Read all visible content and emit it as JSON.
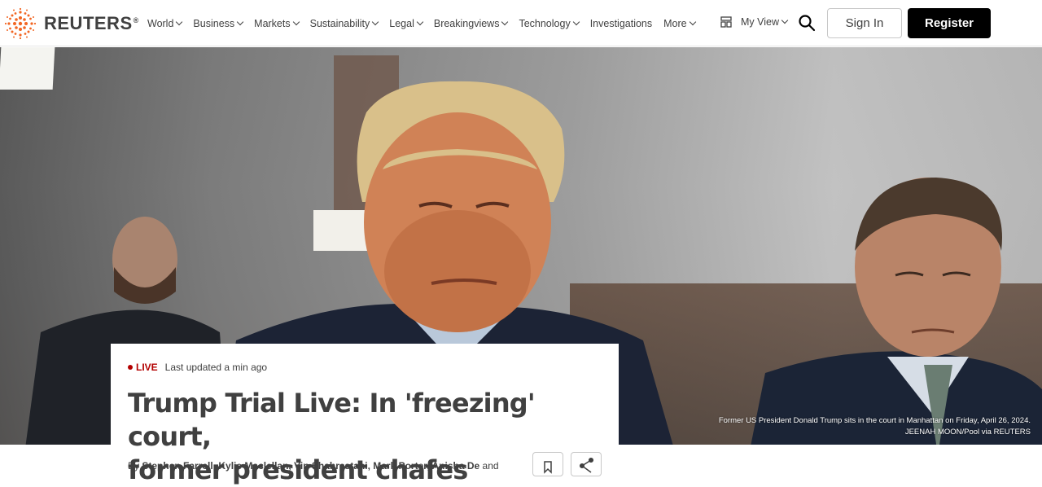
{
  "brand": {
    "name": "REUTERS",
    "registered": "®"
  },
  "nav": {
    "items": [
      {
        "label": "World",
        "dropdown": true
      },
      {
        "label": "Business",
        "dropdown": true
      },
      {
        "label": "Markets",
        "dropdown": true
      },
      {
        "label": "Sustainability",
        "dropdown": true
      },
      {
        "label": "Legal",
        "dropdown": true
      },
      {
        "label": "Breakingviews",
        "dropdown": true
      },
      {
        "label": "Technology",
        "dropdown": true
      },
      {
        "label": "Investigations",
        "dropdown": false
      },
      {
        "label": "More",
        "dropdown": true
      }
    ],
    "my_view": "My View",
    "sign_in": "Sign In",
    "register": "Register"
  },
  "hero": {
    "caption_line1": "Former US President Donald Trump sits in the court in Manhattan on Friday, April 26, 2024.",
    "caption_line2": "JEENAH MOON/Pool via REUTERS"
  },
  "article": {
    "live_label": "LIVE",
    "updated": "Last updated a min ago",
    "headline_line1": "Trump Trial Live: In 'freezing' court,",
    "headline_line2": "former president chafes",
    "byline_prefix": "By",
    "authors": "Stephen Farrell, Kylie Maclellan, Vin Shahrestani, Mark Porter, Anisha De",
    "byline_suffix": "and"
  },
  "colors": {
    "live": "#b30000",
    "logo_orange": "#f26522",
    "register_bg": "#000000"
  }
}
